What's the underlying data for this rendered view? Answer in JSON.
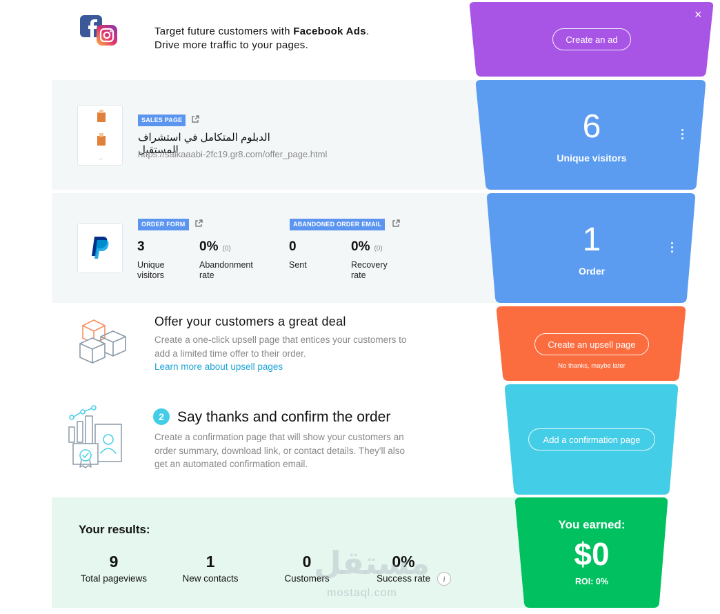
{
  "facebook_ads": {
    "line1_prefix": "Target future customers with ",
    "line1_bold": "Facebook Ads",
    "line1_suffix": ".",
    "line2": "Drive more traffic to your pages.",
    "button_label": "Create an ad",
    "close_label": "×",
    "color": "#a855e6"
  },
  "sales_page": {
    "tag": "SALES PAGE",
    "title": "الدبلوم المتكامل في استشراف المستقبل",
    "url": "https://salkaaabi-2fc19.gr8.com/offer_page.html",
    "funnel_value": "6",
    "funnel_label": "Unique visitors",
    "color": "#5b9cf0"
  },
  "order_form": {
    "tag": "ORDER FORM",
    "abandoned_tag": "ABANDONED ORDER EMAIL",
    "stats": [
      {
        "value": "3",
        "sub": "",
        "label_line1": "Unique",
        "label_line2": "visitors"
      },
      {
        "value": "0%",
        "sub": "(0)",
        "label_line1": "Abandonment",
        "label_line2": "rate"
      },
      {
        "value": "0",
        "sub": "",
        "label_line1": "Sent",
        "label_line2": ""
      },
      {
        "value": "0%",
        "sub": "(0)",
        "label_line1": "Recovery",
        "label_line2": "rate"
      }
    ],
    "funnel_value": "1",
    "funnel_label": "Order",
    "color": "#5b9cf0"
  },
  "upsell": {
    "title": "Offer your customers a great deal",
    "desc_line1": "Create a one-click upsell page that entices your customers to",
    "desc_line2": "add a limited time offer to their order.",
    "link": "Learn more about upsell pages",
    "button_label": "Create an upsell page",
    "skip_label": "No thanks, maybe later",
    "color": "#fb6d3f"
  },
  "confirmation": {
    "step": "2",
    "title": "Say thanks and confirm the order",
    "desc_line1": "Create a confirmation page that will show your customers an",
    "desc_line2": "order summary, download link, or contact details. They'll also",
    "desc_line3": "get an automated confirmation email.",
    "button_label": "Add a confirmation page",
    "color": "#43cde6"
  },
  "results": {
    "title": "Your results:",
    "items": [
      {
        "value": "9",
        "label": "Total pageviews"
      },
      {
        "value": "1",
        "label": "New contacts"
      },
      {
        "value": "0",
        "label": "Customers"
      },
      {
        "value": "0%",
        "label": "Success rate"
      }
    ],
    "info_icon": "i",
    "earned_label": "You earned:",
    "earned_value": "$0",
    "roi": "ROI: 0%",
    "color": "#00c060"
  },
  "watermark": {
    "arabic": "مستقل",
    "latin": "mostaql.com"
  }
}
